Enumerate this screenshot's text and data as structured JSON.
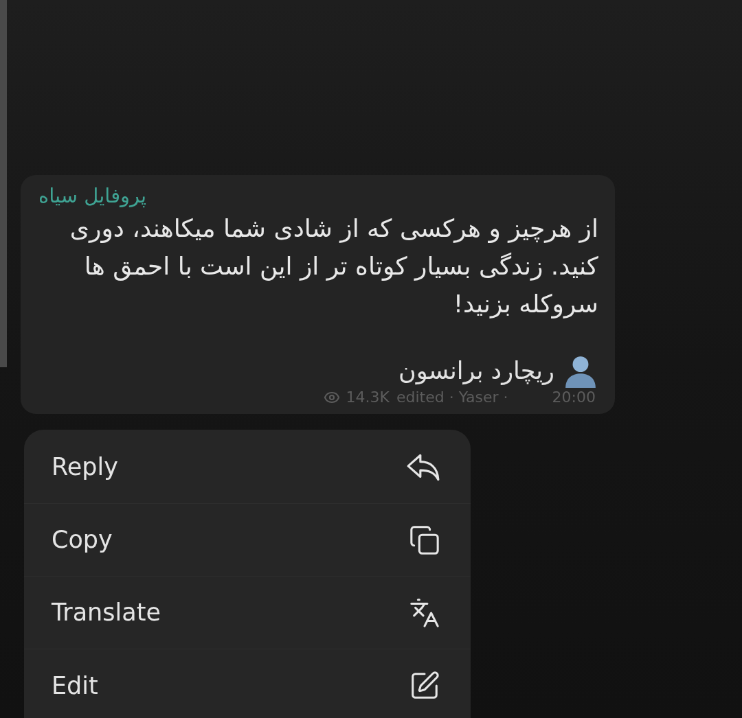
{
  "channel": {
    "name": "پروفایل سیاه"
  },
  "message": {
    "text": "از هرچیز و هرکسی که از شادی شما میکاهند، دوری کنید. زندگی بسیار کوتاه تر از این است با احمق ها سروکله بزنید!",
    "signature": "ریچارد برانسون",
    "views": "14.3K",
    "meta": "edited · Yaser ·",
    "time": "20:00"
  },
  "menu": [
    {
      "label": "Reply",
      "kind": "reply"
    },
    {
      "label": "Copy",
      "kind": "copy"
    },
    {
      "label": "Translate",
      "kind": "translate"
    },
    {
      "label": "Edit",
      "kind": "edit"
    }
  ]
}
